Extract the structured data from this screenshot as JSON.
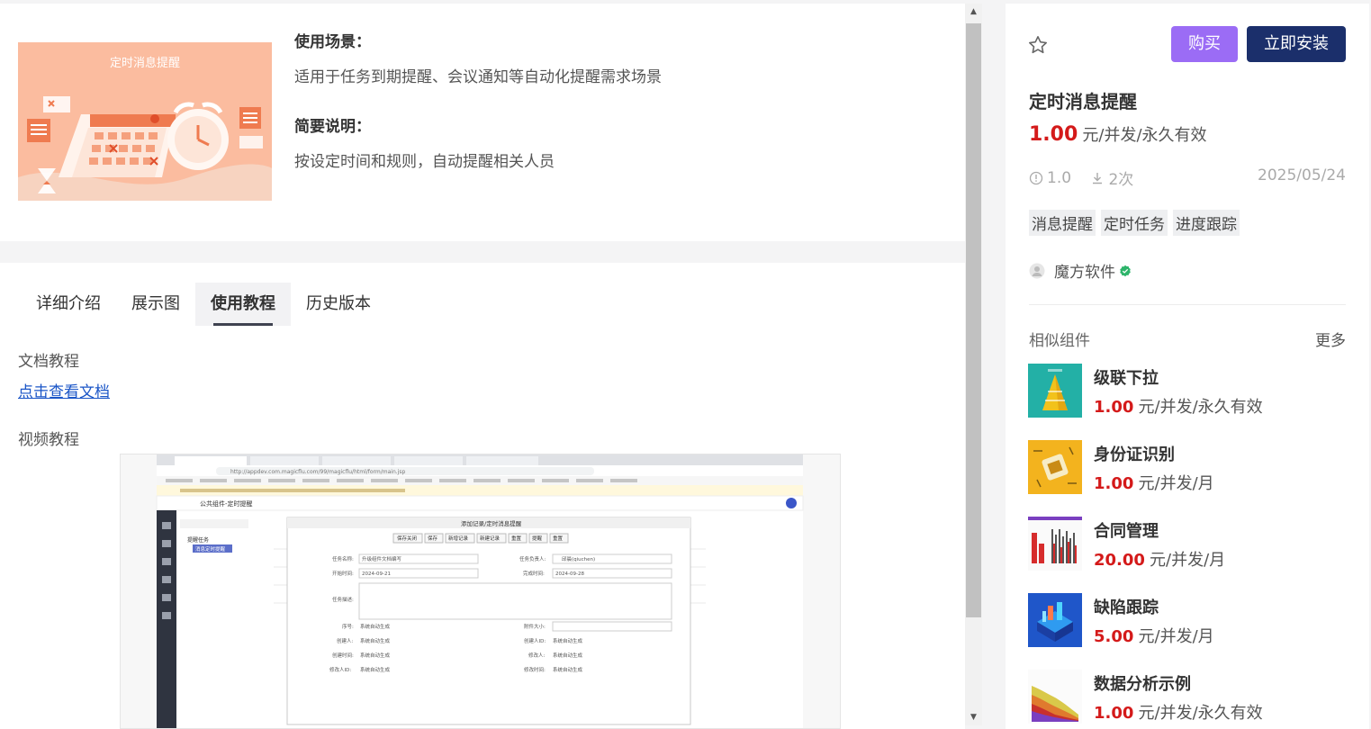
{
  "product": {
    "cover_title": "定时消息提醒",
    "scene_heading": "使用场景：",
    "scene_text": "适用于任务到期提醒、会议通知等自动化提醒需求场景",
    "summary_heading": "简要说明：",
    "summary_text": "按设定时间和规则，自动提醒相关人员"
  },
  "tabs": [
    {
      "label": "详细介绍",
      "active": false
    },
    {
      "label": "展示图",
      "active": false
    },
    {
      "label": "使用教程",
      "active": true
    },
    {
      "label": "历史版本",
      "active": false
    }
  ],
  "tutorial": {
    "doc_label": "文档教程",
    "doc_link": "点击查看文档",
    "video_label": "视频教程"
  },
  "video_frame": {
    "url_bar": "http://appdev.com.magicflu.com/99/magicflu/html/form/main.jsp",
    "app_title": "公共组件-定时提醒",
    "tree_root": "提醒任务",
    "tree_child": "消息定时提醒",
    "dialog_title": "添加记录/定时消息提醒",
    "toolbar": [
      "保存关闭",
      "保存",
      "新增记录",
      "新建记录",
      "重置",
      "提醒",
      "重置"
    ],
    "fields": [
      {
        "label": "任务名称:",
        "value": "升级组件文档编写"
      },
      {
        "label": "任务负责人:",
        "value": "邱晨(qiuchen)"
      },
      {
        "label": "开始时间:",
        "value": "2024-09-21"
      },
      {
        "label": "完成时间:",
        "value": "2024-09-28"
      },
      {
        "label": "任务描述:",
        "value": ""
      },
      {
        "label": "序号:",
        "value": "系统自动生成"
      },
      {
        "label": "附件大小:",
        "value": ""
      },
      {
        "label": "创建人:",
        "value": "系统自动生成"
      },
      {
        "label": "创建人ID:",
        "value": "系统自动生成"
      },
      {
        "label": "创建时间:",
        "value": "系统自动生成"
      },
      {
        "label": "修改人:",
        "value": "系统自动生成"
      },
      {
        "label": "修改人ID:",
        "value": "系统自动生成"
      },
      {
        "label": "修改时间:",
        "value": "系统自动生成"
      }
    ]
  },
  "sidebar": {
    "buy_label": "购买",
    "install_label": "立即安装",
    "title": "定时消息提醒",
    "price": "1.00",
    "price_unit": "元/并发/永久有效",
    "version": "1.0",
    "downloads": "2次",
    "date": "2025/05/24",
    "tags": [
      "消息提醒",
      "定时任务",
      "进度跟踪"
    ],
    "author": "魔方软件",
    "similar_heading": "相似组件",
    "more_label": "更多",
    "similar": [
      {
        "name": "级联下拉",
        "price": "1.00",
        "unit": "元/并发/永久有效",
        "thumb": "pyramid"
      },
      {
        "name": "身份证识别",
        "price": "1.00",
        "unit": "元/并发/月",
        "thumb": "idcard"
      },
      {
        "name": "合同管理",
        "price": "20.00",
        "unit": "元/并发/月",
        "thumb": "barchart"
      },
      {
        "name": "缺陷跟踪",
        "price": "5.00",
        "unit": "元/并发/月",
        "thumb": "iso"
      },
      {
        "name": "数据分析示例",
        "price": "1.00",
        "unit": "元/并发/永久有效",
        "thumb": "area"
      }
    ]
  },
  "colors": {
    "accent_buy": "#9b6cf5",
    "accent_install": "#1b2f6b",
    "price_red": "#d41a1a",
    "link_blue": "#1a55c7",
    "verified_green": "#2db46a"
  }
}
